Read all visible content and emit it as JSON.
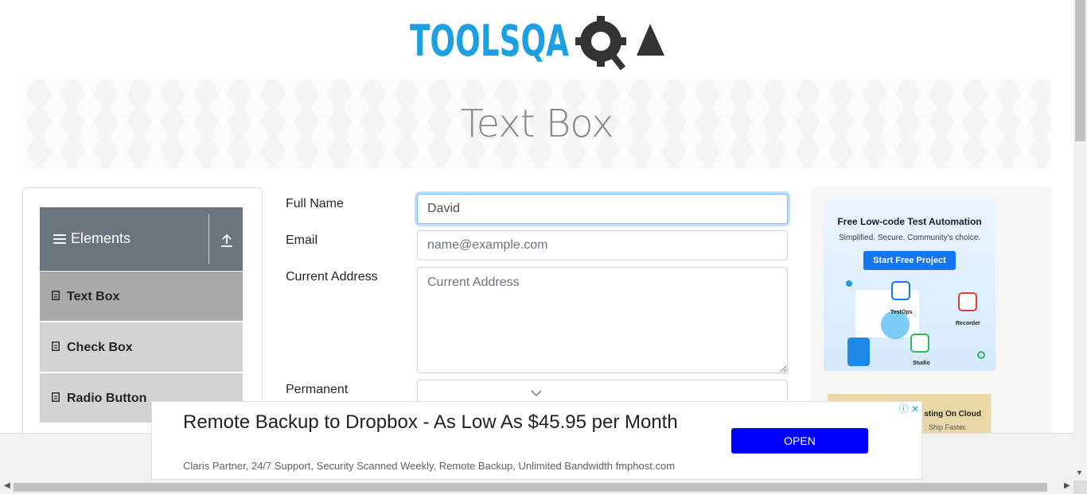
{
  "header": {
    "logo_text": "TOOLSQA"
  },
  "banner": {
    "title": "Text Box"
  },
  "sidebar": {
    "group_title": "Elements",
    "items": [
      {
        "label": "Text Box",
        "active": true
      },
      {
        "label": "Check Box",
        "active": false
      },
      {
        "label": "Radio Button",
        "active": false
      }
    ]
  },
  "form": {
    "full_name": {
      "label": "Full Name",
      "value": "David",
      "placeholder": "Full Name"
    },
    "email": {
      "label": "Email",
      "value": "",
      "placeholder": "name@example.com"
    },
    "current_address": {
      "label": "Current Address",
      "value": "",
      "placeholder": "Current Address"
    },
    "permanent_address": {
      "label": "Permanent"
    }
  },
  "right_ad": {
    "headline": "Free Low-code Test Automation",
    "subline": "Simplified. Secure. Community's choice.",
    "button": "Start Free Project",
    "apps": [
      "TestOps",
      "Recorder",
      "Studio"
    ],
    "second_title": "sting On Cloud",
    "second_sub": ". Ship Faster."
  },
  "bottom_ad": {
    "headline": "Remote Backup to Dropbox - As Low As $45.95 per Month",
    "description": "Claris Partner, 24/7 Support, Security Scanned Weekly, Remote Backup, Unlimited Bandwidth fmphost.com",
    "button": "OPEN"
  },
  "colors": {
    "brand_blue": "#1ba1e2",
    "brand_dark": "#333333",
    "sidebar_header": "#6c757d",
    "active_item": "#a9a9a9",
    "ad_button": "#0000ff"
  }
}
